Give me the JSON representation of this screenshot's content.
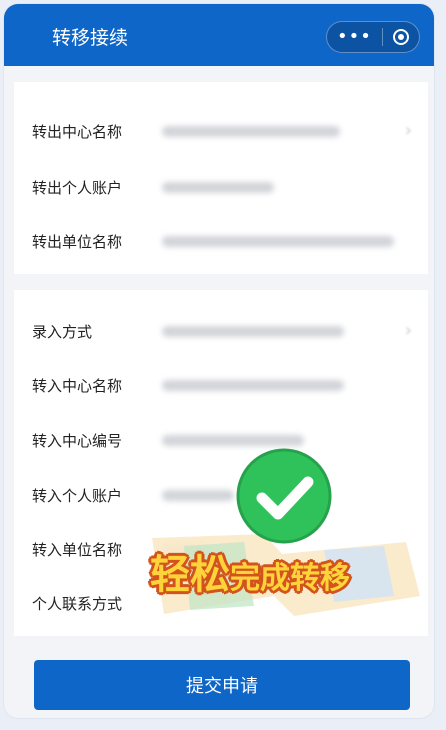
{
  "navbar": {
    "title": "转移接续",
    "more_icon": "more-dots-icon",
    "close_icon": "target-circle-icon"
  },
  "transfer_out": {
    "rows": [
      {
        "label": "转出中心名称",
        "has_chevron": true
      },
      {
        "label": "转出个人账户",
        "has_chevron": false
      },
      {
        "label": "转出单位名称",
        "has_chevron": false
      }
    ]
  },
  "transfer_in": {
    "rows": [
      {
        "label": "录入方式",
        "has_chevron": true
      },
      {
        "label": "转入中心名称",
        "has_chevron": false
      },
      {
        "label": "转入中心编号",
        "has_chevron": false
      },
      {
        "label": "转入个人账户",
        "has_chevron": false
      },
      {
        "label": "转入单位名称",
        "has_chevron": false
      },
      {
        "label": "个人联系方式",
        "has_chevron": false
      }
    ]
  },
  "submit_label": "提交申请",
  "promo": {
    "big": "轻松",
    "small": "完成转移",
    "badge_color": "#2fc25b"
  },
  "colors": {
    "primary": "#0f66c9",
    "page_bg": "#f2f4f8"
  }
}
